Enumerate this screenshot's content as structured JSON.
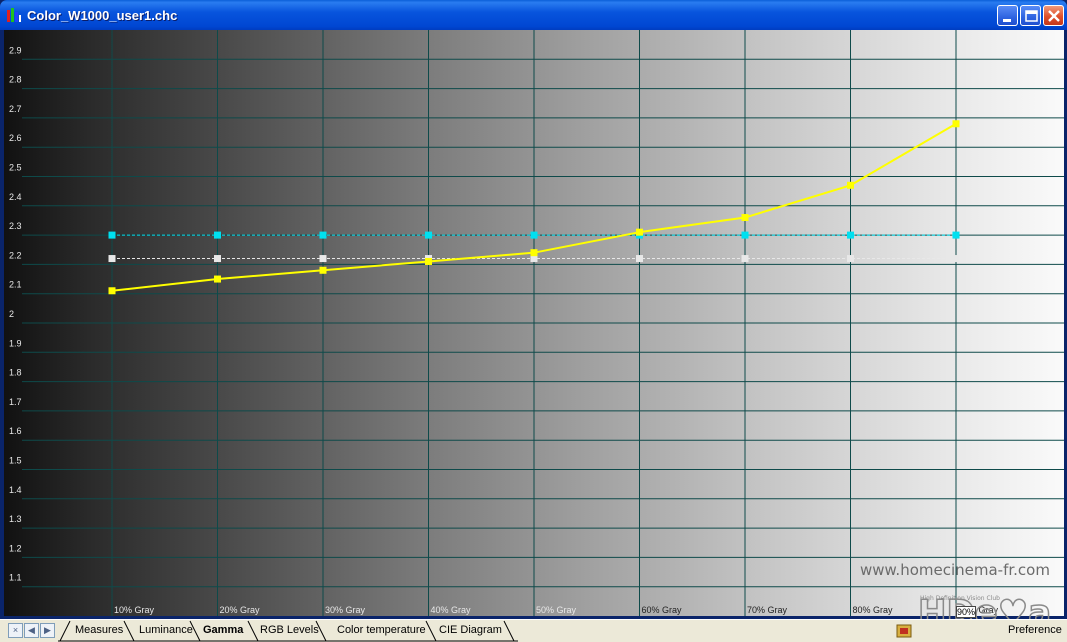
{
  "window": {
    "title": "Color_W1000_user1.chc",
    "minimize_label": "Minimize",
    "maximize_label": "Maximize",
    "close_label": "Close"
  },
  "colors": {
    "measured": "#ffff00",
    "target": "#00e0f0",
    "reference": "#e8e8e8",
    "grid": "#0e4a4a"
  },
  "chart_data": {
    "type": "line",
    "categories": [
      "10% Gray",
      "20% Gray",
      "30% Gray",
      "40% Gray",
      "50% Gray",
      "60% Gray",
      "70% Gray",
      "80% Gray",
      "90% Gray"
    ],
    "y_ticks": [
      "1.1",
      "1.2",
      "1.3",
      "1.4",
      "1.5",
      "1.6",
      "1.7",
      "1.8",
      "1.9",
      "2",
      "2.1",
      "2.2",
      "2.3",
      "2.4",
      "2.5",
      "2.6",
      "2.7",
      "2.8",
      "2.9"
    ],
    "ylim": [
      1.0,
      3.0
    ],
    "grid": true,
    "series": [
      {
        "values": [
          2.11,
          2.15,
          2.18,
          2.21,
          2.24,
          2.31,
          2.36,
          2.47,
          2.68
        ],
        "color": "#ffff00",
        "style": "solid"
      },
      {
        "values": [
          2.3,
          2.3,
          2.3,
          2.3,
          2.3,
          2.3,
          2.3,
          2.3,
          2.3
        ],
        "color": "#00e0f0",
        "style": "dashed"
      },
      {
        "values": [
          2.22,
          2.22,
          2.22,
          2.22,
          2.22,
          2.22,
          2.22,
          2.22,
          2.22
        ],
        "color": "#e8e8e8",
        "style": "dashed"
      }
    ]
  },
  "tabs": [
    {
      "label": "Measures",
      "active": false
    },
    {
      "label": "Luminance",
      "active": false
    },
    {
      "label": "Gamma",
      "active": true
    },
    {
      "label": "RGB Levels",
      "active": false
    },
    {
      "label": "Color temperature",
      "active": false
    },
    {
      "label": "CIE Diagram",
      "active": false
    }
  ],
  "nav_buttons": [
    "×",
    "◀",
    "▶"
  ],
  "watermark": {
    "site": "www.homecinema-fr.com",
    "logo_text": "HDe♥a",
    "logo_sub": "High Definition Vision Club"
  },
  "status": {
    "preference_label": "Preference",
    "level_box": "90%"
  }
}
